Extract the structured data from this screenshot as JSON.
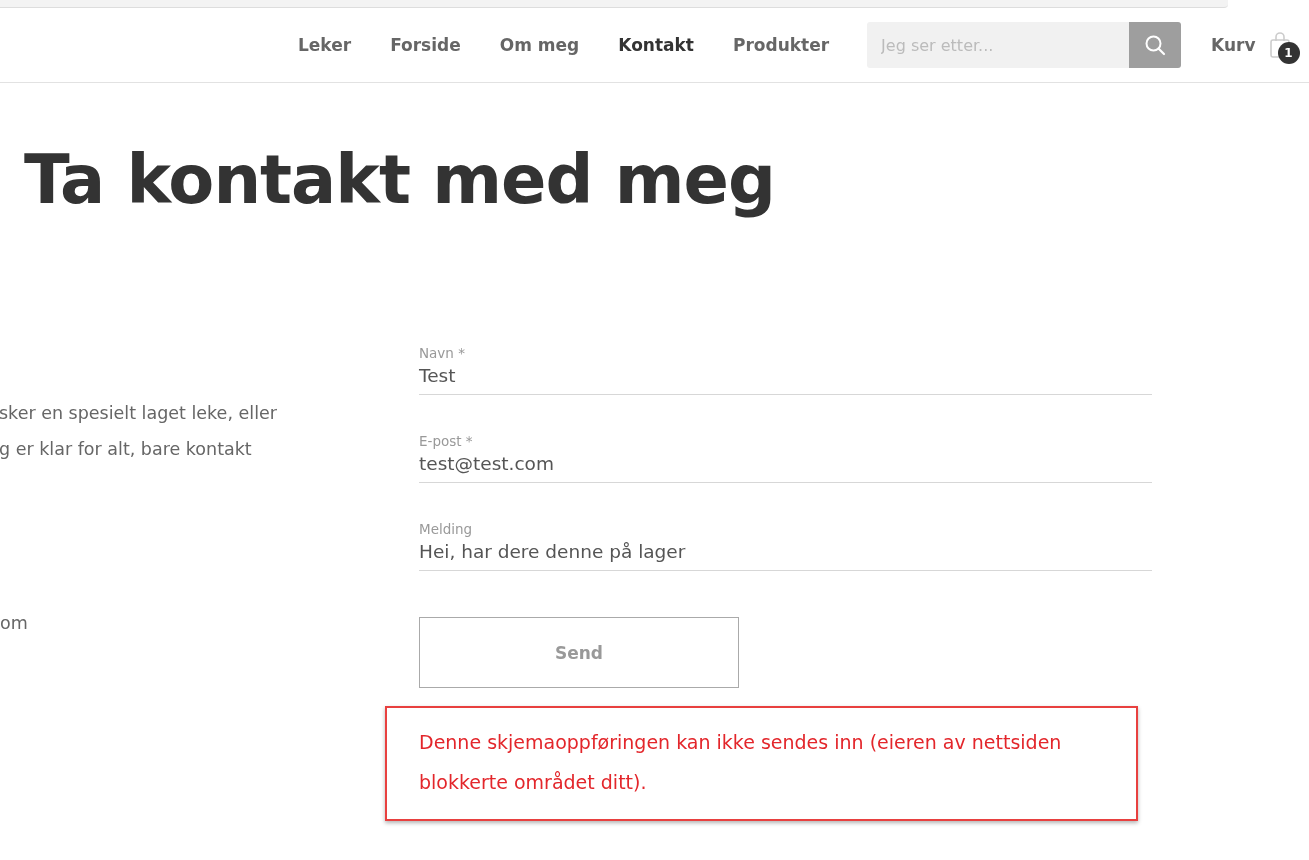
{
  "nav": [
    {
      "label": "Leker",
      "selected": false
    },
    {
      "label": "Forside",
      "selected": false
    },
    {
      "label": "Om meg",
      "selected": false
    },
    {
      "label": "Kontakt",
      "selected": true
    },
    {
      "label": "Produkter",
      "selected": false
    }
  ],
  "search": {
    "placeholder": "Jeg ser etter..."
  },
  "cart": {
    "label": "Kurv",
    "count": "1"
  },
  "title": "Ta kontakt med meg",
  "intro_lines": [
    "sker en spesielt laget leke, eller",
    "g er klar for alt, bare kontakt"
  ],
  "contact_fragment": "om",
  "form": {
    "fields": [
      {
        "label": "Navn *",
        "value": "Test"
      },
      {
        "label": "E-post *",
        "value": "test@test.com"
      },
      {
        "label": "Melding",
        "value": "Hei, har dere denne på lager"
      }
    ],
    "submit": "Send",
    "error": "Denne skjemaoppføringen kan ikke sendes inn (eieren av nettsiden blokkerte området ditt)."
  }
}
